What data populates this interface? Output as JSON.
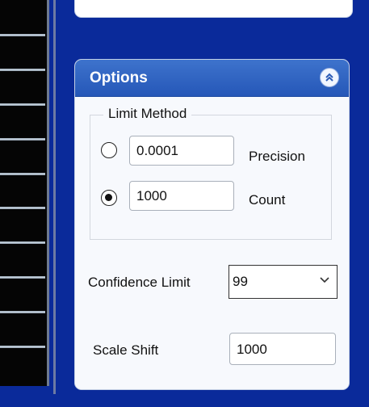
{
  "options": {
    "title": "Options",
    "collapse_icon": "double-chevron-up-icon"
  },
  "limit_method": {
    "legend": "Limit Method",
    "precision_value": "0.0001",
    "precision_label": "Precision",
    "precision_selected": false,
    "count_value": "1000",
    "count_label": "Count",
    "count_selected": true
  },
  "confidence_limit": {
    "label": "Confidence Limit",
    "selected": "99"
  },
  "scale_shift": {
    "label": "Scale Shift",
    "value": "1000"
  }
}
